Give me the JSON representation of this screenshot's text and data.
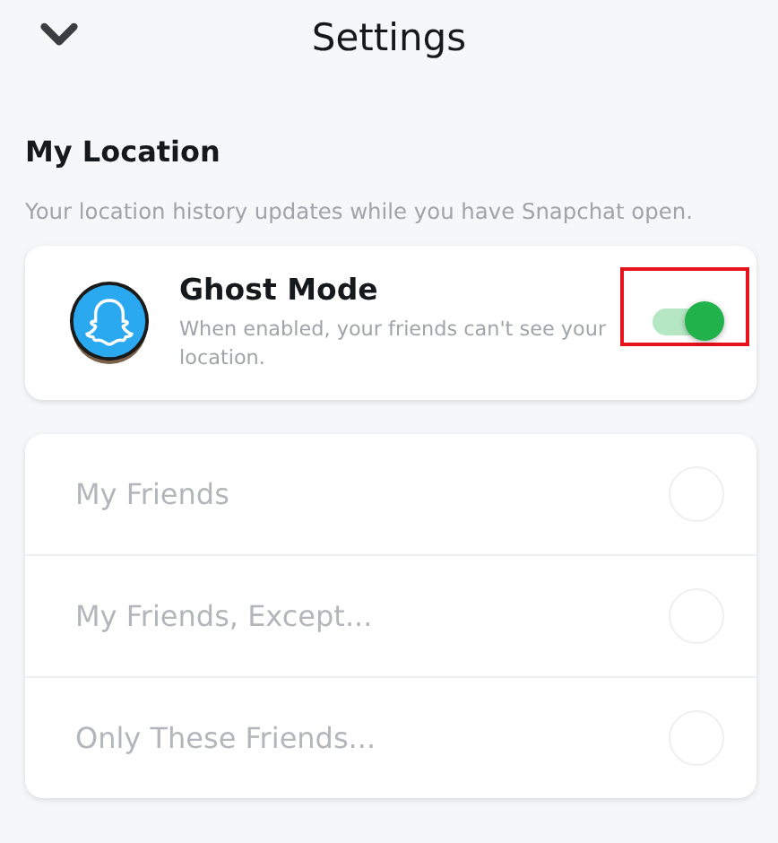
{
  "header": {
    "title": "Settings"
  },
  "section": {
    "title": "My Location",
    "description": "Your location history updates while you have Snapchat open."
  },
  "ghost_mode": {
    "title": "Ghost Mode",
    "description": "When enabled, your friends can't see your location.",
    "on": true,
    "highlighted": true
  },
  "options": [
    {
      "label": "My Friends",
      "selected": false,
      "disabled": true
    },
    {
      "label": "My Friends, Except...",
      "selected": false,
      "disabled": true
    },
    {
      "label": "Only These Friends...",
      "selected": false,
      "disabled": true
    }
  ]
}
